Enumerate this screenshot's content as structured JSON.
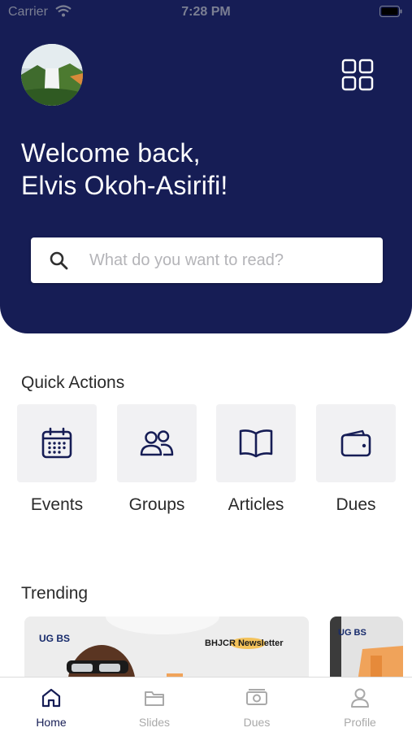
{
  "status_bar": {
    "carrier": "Carrier",
    "time": "7:28 PM"
  },
  "header": {
    "welcome_line1": "Welcome back,",
    "welcome_line2": "Elvis Okoh-Asirifi!",
    "avatar_icon": "waterfall-photo",
    "menu_icon": "grid-icon"
  },
  "search": {
    "placeholder": "What do you want to read?",
    "value": ""
  },
  "quick_actions": {
    "title": "Quick Actions",
    "items": [
      {
        "label": "Events",
        "icon": "calendar-icon"
      },
      {
        "label": "Groups",
        "icon": "users-icon"
      },
      {
        "label": "Articles",
        "icon": "book-icon"
      },
      {
        "label": "Dues",
        "icon": "wallet-icon"
      }
    ]
  },
  "trending": {
    "title": "Trending",
    "cards": [
      {
        "logo": "UG BS",
        "label": "BHJCR Newsletter"
      },
      {
        "logo": "UG BS"
      }
    ]
  },
  "tabbar": {
    "items": [
      {
        "label": "Home",
        "icon": "home-icon",
        "active": true
      },
      {
        "label": "Slides",
        "icon": "folder-icon",
        "active": false
      },
      {
        "label": "Dues",
        "icon": "money-icon",
        "active": false
      },
      {
        "label": "Profile",
        "icon": "person-icon",
        "active": false
      }
    ]
  },
  "colors": {
    "primary": "#161d55",
    "tile_bg": "#f1f1f3",
    "inactive": "#a9a9a9",
    "accent_orange": "#f0a35a"
  }
}
